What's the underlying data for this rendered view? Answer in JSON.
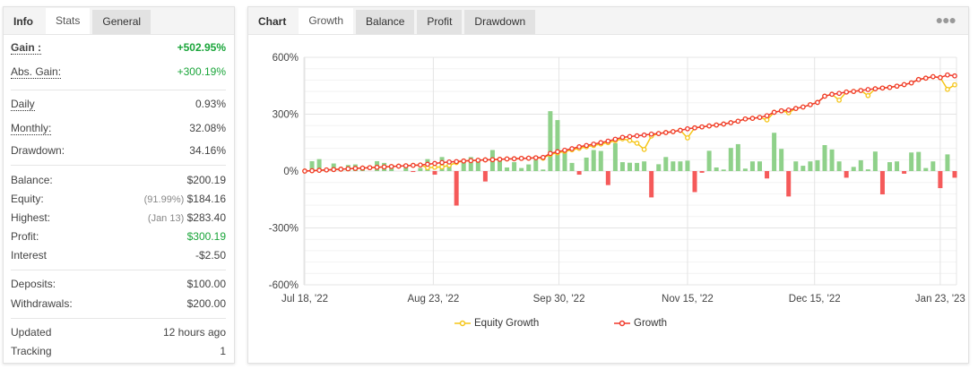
{
  "left_tabs": [
    "Info",
    "Stats",
    "General"
  ],
  "stats": {
    "gain": {
      "label": "Gain :",
      "value": "+502.95%"
    },
    "abs_gain": {
      "label": "Abs. Gain:",
      "value": "+300.19%"
    },
    "daily": {
      "label": "Daily",
      "value": "0.93%"
    },
    "monthly": {
      "label": "Monthly:",
      "value": "32.08%"
    },
    "drawdown": {
      "label": "Drawdown:",
      "value": "34.16%"
    },
    "balance": {
      "label": "Balance:",
      "value": "$200.19"
    },
    "equity": {
      "label": "Equity:",
      "note": "(91.99%)",
      "value": "$184.16"
    },
    "highest": {
      "label": "Highest:",
      "note": "(Jan 13)",
      "value": "$283.40"
    },
    "profit": {
      "label": "Profit:",
      "value": "$300.19"
    },
    "interest": {
      "label": "Interest",
      "value": "-$2.50"
    },
    "deposits": {
      "label": "Deposits:",
      "value": "$100.00"
    },
    "withdrawals": {
      "label": "Withdrawals:",
      "value": "$200.00"
    },
    "updated": {
      "label": "Updated",
      "value": "12 hours ago"
    },
    "tracking": {
      "label": "Tracking",
      "value": "1"
    }
  },
  "right_tabs": {
    "title": "Chart",
    "items": [
      "Growth",
      "Balance",
      "Profit",
      "Drawdown"
    ]
  },
  "more_icon": "more-dots-icon",
  "colors": {
    "green": "#1aa53a",
    "bar_pos": "#8fd18a",
    "bar_neg": "#f55a5a",
    "growth": "#f0392b",
    "equity": "#f5c518"
  },
  "chart_data": {
    "type": "line",
    "ylim": [
      -600,
      600
    ],
    "yticks": [
      "600%",
      "300%",
      "0%",
      "-300%",
      "-600%"
    ],
    "ytick_values": [
      600,
      300,
      0,
      -300,
      -600
    ],
    "xticks": [
      {
        "label": "Jul 18, '22",
        "index": 0
      },
      {
        "label": "Aug 23, '22",
        "index": 17.8
      },
      {
        "label": "Sep 30, '22",
        "index": 35.2
      },
      {
        "label": "Nov 15, '22",
        "index": 53
      },
      {
        "label": "Dec 15, '22",
        "index": 70.6
      },
      {
        "label": "Jan 23, '23",
        "index": 88
      }
    ],
    "legend": [
      "Equity Growth",
      "Growth"
    ],
    "series": [
      {
        "name": "Growth",
        "values": [
          0,
          2,
          4,
          6,
          8,
          10,
          12,
          14,
          16,
          18,
          20,
          22,
          24,
          26,
          28,
          30,
          32,
          36,
          40,
          45,
          48,
          50,
          53,
          55,
          57,
          59,
          60,
          62,
          64,
          65,
          67,
          68,
          70,
          72,
          93,
          102,
          110,
          118,
          128,
          135,
          142,
          150,
          158,
          168,
          178,
          182,
          186,
          190,
          195,
          198,
          203,
          208,
          215,
          223,
          228,
          233,
          238,
          243,
          248,
          255,
          263,
          275,
          278,
          283,
          292,
          310,
          318,
          322,
          330,
          338,
          350,
          362,
          395,
          405,
          410,
          417,
          420,
          425,
          430,
          434,
          438,
          441,
          448,
          456,
          465,
          483,
          490,
          498,
          493,
          507,
          502
        ]
      },
      {
        "name": "Equity Growth",
        "values": [
          0,
          2,
          4,
          6,
          8,
          10,
          12,
          14,
          16,
          18,
          20,
          22,
          24,
          26,
          28,
          30,
          32,
          18,
          20,
          22,
          30,
          45,
          53,
          55,
          57,
          59,
          60,
          62,
          64,
          65,
          67,
          68,
          70,
          68,
          88,
          96,
          104,
          112,
          120,
          128,
          135,
          143,
          150,
          160,
          170,
          161,
          147,
          114,
          185,
          198,
          203,
          208,
          215,
          175,
          228,
          233,
          238,
          243,
          248,
          255,
          263,
          275,
          278,
          283,
          270,
          310,
          318,
          308,
          330,
          338,
          350,
          362,
          395,
          405,
          374,
          417,
          420,
          425,
          398,
          434,
          438,
          441,
          448,
          456,
          465,
          483,
          490,
          498,
          493,
          431,
          455
        ]
      },
      {
        "name": "Daily",
        "type": "bar",
        "values": [
          0,
          52,
          63,
          0,
          40,
          5,
          32,
          35,
          19,
          0,
          52,
          43,
          32,
          0,
          32,
          -5,
          16,
          63,
          -19,
          74,
          55,
          -182,
          52,
          74,
          52,
          -55,
          111,
          63,
          19,
          47,
          16,
          35,
          58,
          8,
          316,
          269,
          103,
          43,
          -19,
          71,
          111,
          106,
          -74,
          147,
          47,
          44,
          43,
          51,
          -139,
          36,
          74,
          51,
          51,
          55,
          -111,
          -9,
          107,
          19,
          8,
          122,
          142,
          13,
          51,
          51,
          -39,
          202,
          117,
          -134,
          51,
          28,
          51,
          57,
          137,
          114,
          51,
          -35,
          22,
          57,
          9,
          103,
          -123,
          47,
          51,
          -14,
          98,
          101,
          16,
          51,
          -90,
          88,
          -35
        ]
      }
    ]
  }
}
